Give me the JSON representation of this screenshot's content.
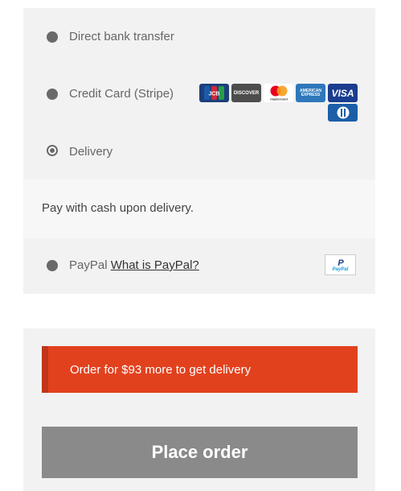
{
  "payment_methods": [
    {
      "label": "Direct bank transfer",
      "selected": false
    },
    {
      "label": "Credit Card (Stripe)",
      "selected": false
    },
    {
      "label": "Delivery",
      "selected": true,
      "description": "Pay with cash upon delivery."
    },
    {
      "label": "PayPal",
      "link": "What is PayPal?",
      "selected": false
    }
  ],
  "card_icons": [
    "JCB",
    "DISCOVER",
    "mastercard",
    "AMERICAN EXPRESS",
    "VISA",
    "Diners Club"
  ],
  "paypal_logo": "PayPal",
  "notice": {
    "text": "Order for $93 more to get delivery",
    "color": "#e2411e"
  },
  "place_order": {
    "label": "Place order",
    "color": "#8a8a8a"
  }
}
